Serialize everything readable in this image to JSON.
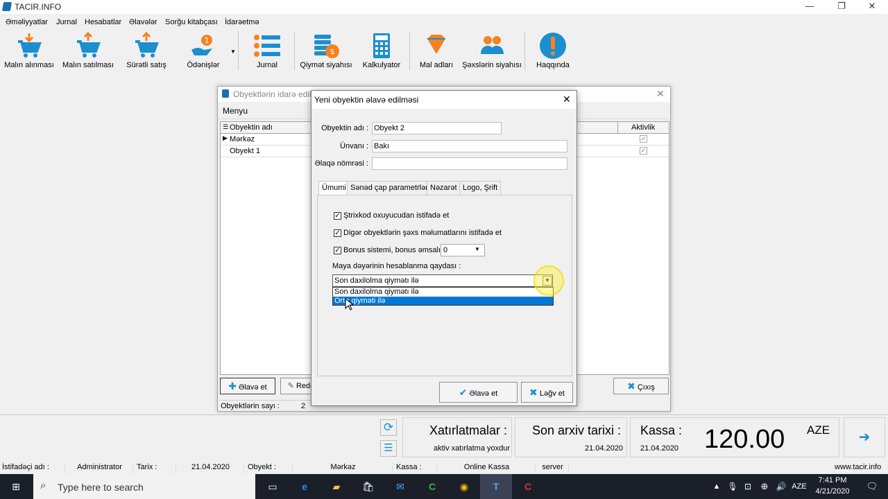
{
  "app": {
    "title": "TACIR.INFO"
  },
  "window_controls": {
    "minimize": "—",
    "restore": "❐",
    "close": "✕"
  },
  "menu": [
    "Əməliyyatlar",
    "Jurnal",
    "Hesabatlar",
    "Əlavələr",
    "Sorğu kitabçası",
    "İdarəetmə"
  ],
  "toolbar": [
    {
      "label": "Malın alınması",
      "icon": "cart-down-icon"
    },
    {
      "label": "Malın satılması",
      "icon": "cart-up-icon"
    },
    {
      "label": "Sürətli satış",
      "icon": "cart-fast-icon"
    },
    {
      "label": "Ödənişlər",
      "icon": "payments-icon"
    },
    {
      "label": "Jurnal",
      "icon": "list-icon"
    },
    {
      "label": "Qiymət siyahısı",
      "icon": "coins-icon"
    },
    {
      "label": "Kalkulyator",
      "icon": "calculator-icon"
    },
    {
      "label": "Mal adları",
      "icon": "diamond-icon"
    },
    {
      "label": "Şəxslərin siyahısı",
      "icon": "people-icon"
    },
    {
      "label": "Haqqında",
      "icon": "info-icon"
    }
  ],
  "objwin": {
    "title": "Obyektlərin idarə edilm",
    "menu": "Menyu",
    "col_name": "Obyektin adı",
    "col_active": "Aktivlik",
    "rows": [
      {
        "name": "Mərkəz",
        "active": "✓"
      },
      {
        "name": "Obyekt 1",
        "active": "✓"
      }
    ],
    "add_button": "Əlavə et",
    "edit_button": "Reda",
    "exit_button": "Çıxış",
    "count_label": "Obyektlərin sayı :",
    "count_value": "2"
  },
  "dialog": {
    "title": "Yeni obyektin əlavə edilməsi",
    "name_label": "Obyektin adı :",
    "name_value": "Obyekt 2",
    "address_label": "Ünvanı :",
    "address_value": "Bakı",
    "phone_label": "Əlaqə nömrəsi :",
    "phone_value": "",
    "tabs": [
      "Ümumi",
      "Sənəd çap parametrləri",
      "Nəzarət",
      "Logo, Şrift"
    ],
    "check1": "Ştrixkod oxuyucudan istifadə et",
    "check2": "Digər obyektlərin şəxs məlumatlarını istifadə et",
    "check3": "Bonus sistemi,  bonus əmsalı :",
    "bonus_value": "0",
    "cost_label": "Maya dəyərinin hesablanma qaydası :",
    "cost_value": "Son daxilolma qiymətı ilə",
    "options": [
      "Son daxilolma qiymətı ilə",
      "Orta qiyməti ilə"
    ],
    "ok_button": "Əlavə et",
    "cancel_button": "Ləğv et",
    "check_mark": "✓"
  },
  "bottom": {
    "debts_title": "Xatırlatmalar :",
    "debts_value": "aktiv xatırlatma yoxdur",
    "archive_title": "Son arxiv tarixi :",
    "archive_date": "21.04.2020",
    "cash_title": "Kassa :",
    "cash_date": "21.04.2020",
    "amount": "120.00",
    "currency": "AZE"
  },
  "status": {
    "user_label": "İstifadəçi adı :",
    "user": "Administrator",
    "date_label": "Tarix :",
    "date": "21.04.2020",
    "object_label": "Obyekt :",
    "object": "Mərkəz",
    "cash_label": "Kassa :",
    "cash": "Online Kassa",
    "server": "server",
    "site": "www.tacir.info"
  },
  "taskbar": {
    "search": "Type here to search",
    "lang": "AZE",
    "time": "7:41 PM",
    "date": "4/21/2020"
  },
  "colors": {
    "accent": "#1b8fd0",
    "orange": "#f58220",
    "selection": "#0078d7"
  }
}
